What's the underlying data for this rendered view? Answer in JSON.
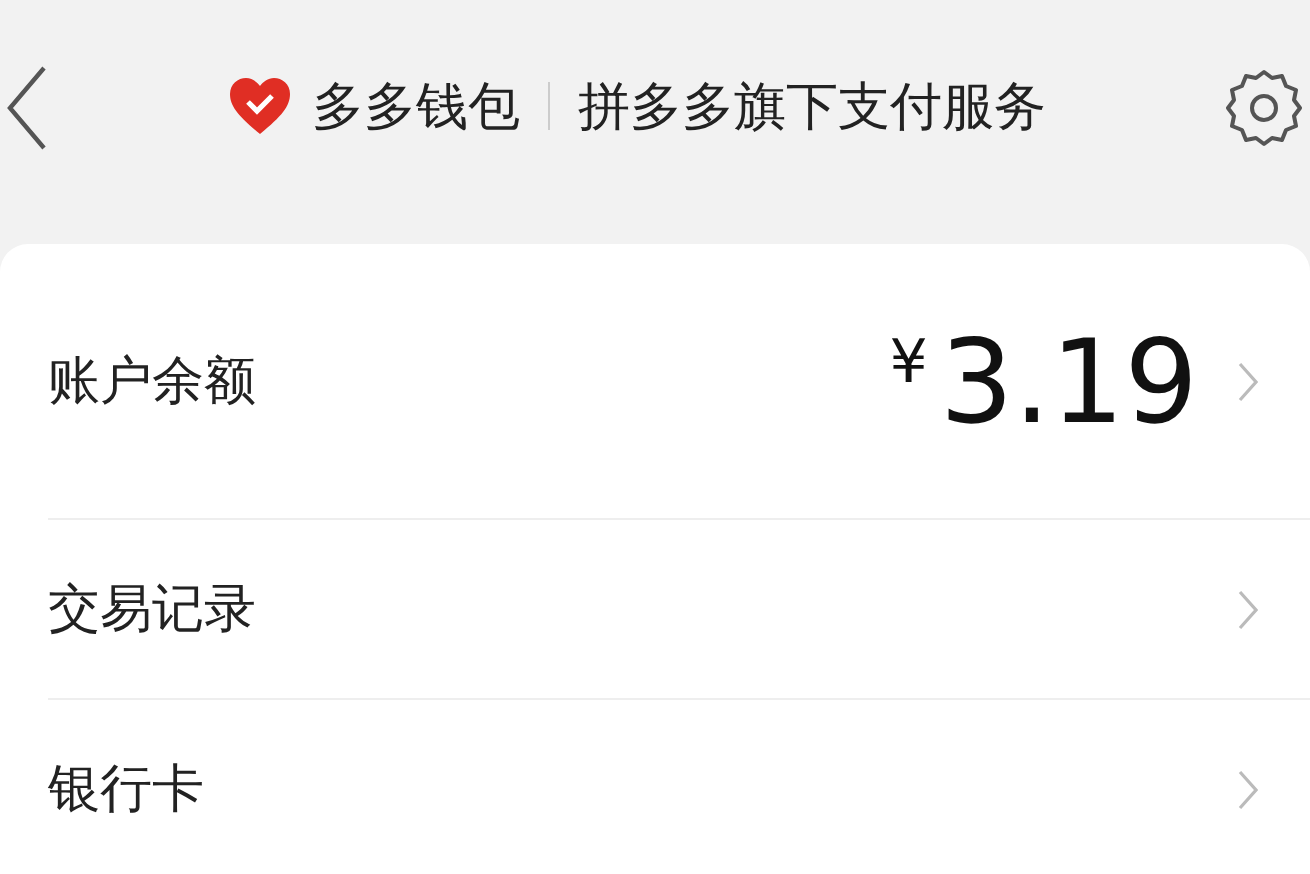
{
  "header": {
    "brand": "多多钱包",
    "subtitle": "拼多多旗下支付服务"
  },
  "rows": [
    {
      "kind": "balance",
      "label": "账户余额",
      "currency": "¥",
      "amount": "3.19"
    },
    {
      "kind": "link",
      "label": "交易记录"
    },
    {
      "kind": "link",
      "label": "银行卡"
    }
  ]
}
